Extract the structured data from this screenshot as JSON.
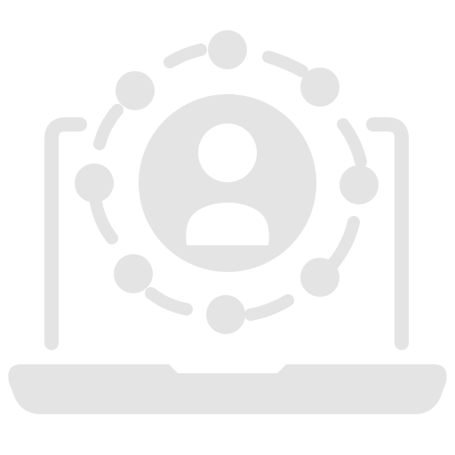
{
  "icon": {
    "name": "laptop-user-network-icon",
    "color": "#e4e4e4"
  }
}
